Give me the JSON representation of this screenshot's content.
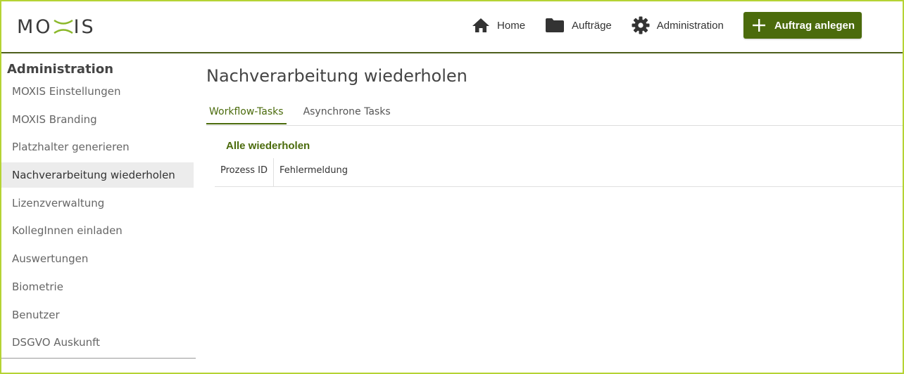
{
  "header": {
    "logo_text_left": "MO",
    "logo_text_right": "IS",
    "nav": {
      "home": "Home",
      "orders": "Aufträge",
      "admin": "Administration"
    },
    "create_button": "Auftrag anlegen"
  },
  "sidebar": {
    "title": "Administration",
    "items": [
      {
        "label": "MOXIS Einstellungen"
      },
      {
        "label": "MOXIS Branding"
      },
      {
        "label": "Platzhalter generieren"
      },
      {
        "label": "Nachverarbeitung wiederholen"
      },
      {
        "label": "Lizenzverwaltung"
      },
      {
        "label": "KollegInnen einladen"
      },
      {
        "label": "Auswertungen"
      },
      {
        "label": "Biometrie"
      },
      {
        "label": "Benutzer"
      },
      {
        "label": "DSGVO Auskunft"
      }
    ],
    "active_index": 3
  },
  "main": {
    "title": "Nachverarbeitung wiederholen",
    "tabs": [
      {
        "label": "Workflow-Tasks"
      },
      {
        "label": "Asynchrone Tasks"
      }
    ],
    "retry_all": "Alle wiederholen",
    "table": {
      "columns": [
        "Prozess ID",
        "Fehlermeldung"
      ]
    }
  },
  "colors": {
    "accent": "#4b6b0c",
    "frame": "#b5d334"
  },
  "icons": {
    "home": "home-icon",
    "orders": "folder-icon",
    "admin": "gear-icon",
    "create": "plus-icon"
  }
}
